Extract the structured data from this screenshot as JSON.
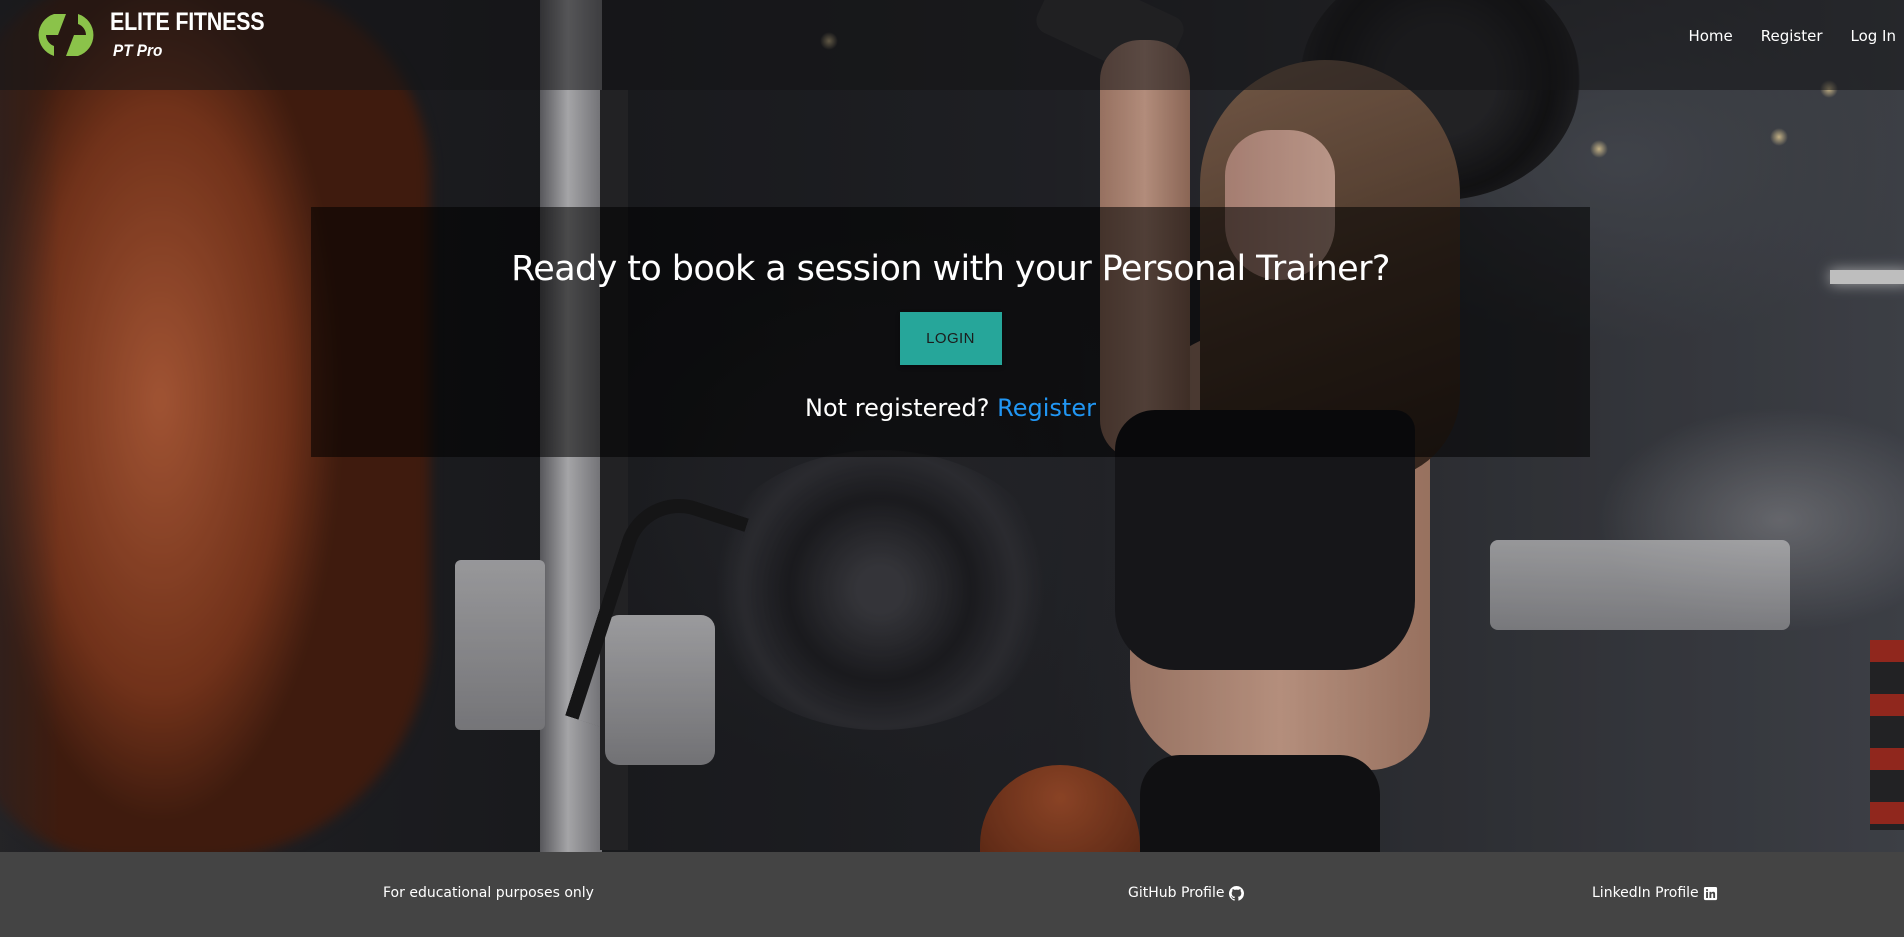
{
  "brand": {
    "title": "ELITE FITNESS",
    "subtitle": "PT Pro",
    "logo_icon": "lightning-bolt-circle-icon",
    "logo_color": "#8bc34a"
  },
  "nav": {
    "items": [
      {
        "label": "Home"
      },
      {
        "label": "Register"
      },
      {
        "label": "Log In"
      }
    ]
  },
  "hero": {
    "background_image": "woman-training-in-gym-photo",
    "heading": "Ready to book a session with your Personal Trainer?",
    "login_button": "LOGIN",
    "register_prompt": "Not registered?",
    "register_link": "Register"
  },
  "footer": {
    "note": "For educational purposes only",
    "github": {
      "label": "GitHub Profile",
      "icon": "github-icon"
    },
    "linkedin": {
      "label": "LinkedIn Profile",
      "icon": "linkedin-icon"
    }
  },
  "colors": {
    "accent": "#26a69a",
    "link": "#2196f3",
    "footer_bg": "#444444"
  }
}
